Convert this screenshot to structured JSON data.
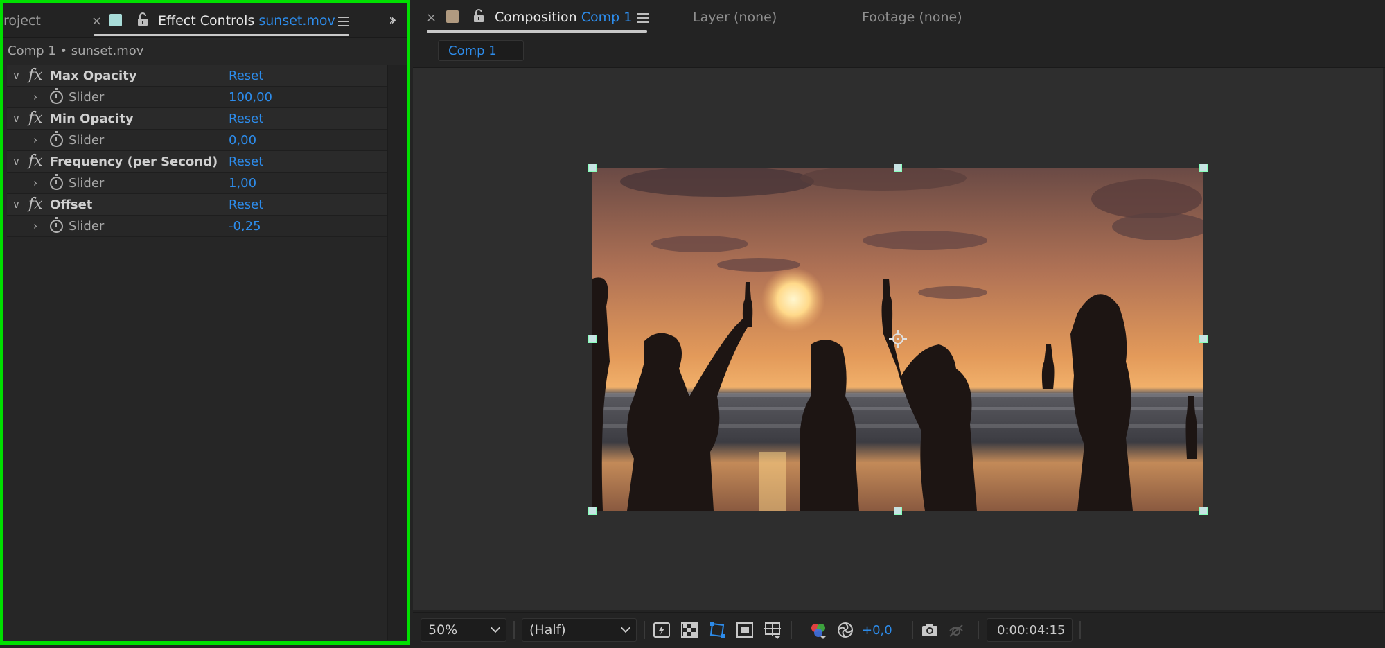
{
  "left_panel": {
    "project_tab": "roject",
    "effect_controls_label": "Effect Controls",
    "effect_controls_file": "sunset.mov",
    "header": "Comp 1 • sunset.mov",
    "effects": [
      {
        "name": "Max Opacity",
        "reset": "Reset",
        "param": "Slider",
        "value": "100,00"
      },
      {
        "name": "Min Opacity",
        "reset": "Reset",
        "param": "Slider",
        "value": "0,00"
      },
      {
        "name": "Frequency (per Second)",
        "reset": "Reset",
        "param": "Slider",
        "value": "1,00"
      },
      {
        "name": "Offset",
        "reset": "Reset",
        "param": "Slider",
        "value": "-0,25"
      }
    ],
    "fx_symbol": "fx",
    "swatch_color": "#a8dcd8"
  },
  "right_panel": {
    "composition_label": "Composition",
    "composition_name": "Comp 1",
    "layer_tab": "Layer (none)",
    "footage_tab": "Footage (none)",
    "comp_pill": "Comp 1",
    "swatch_color": "#b09a80"
  },
  "bottom_bar": {
    "zoom": "50%",
    "resolution": "(Half)",
    "exposure": "+0,0",
    "timecode": "0:00:04:15"
  },
  "accent_color": "#2d8ceb",
  "highlight_color": "#00e000"
}
